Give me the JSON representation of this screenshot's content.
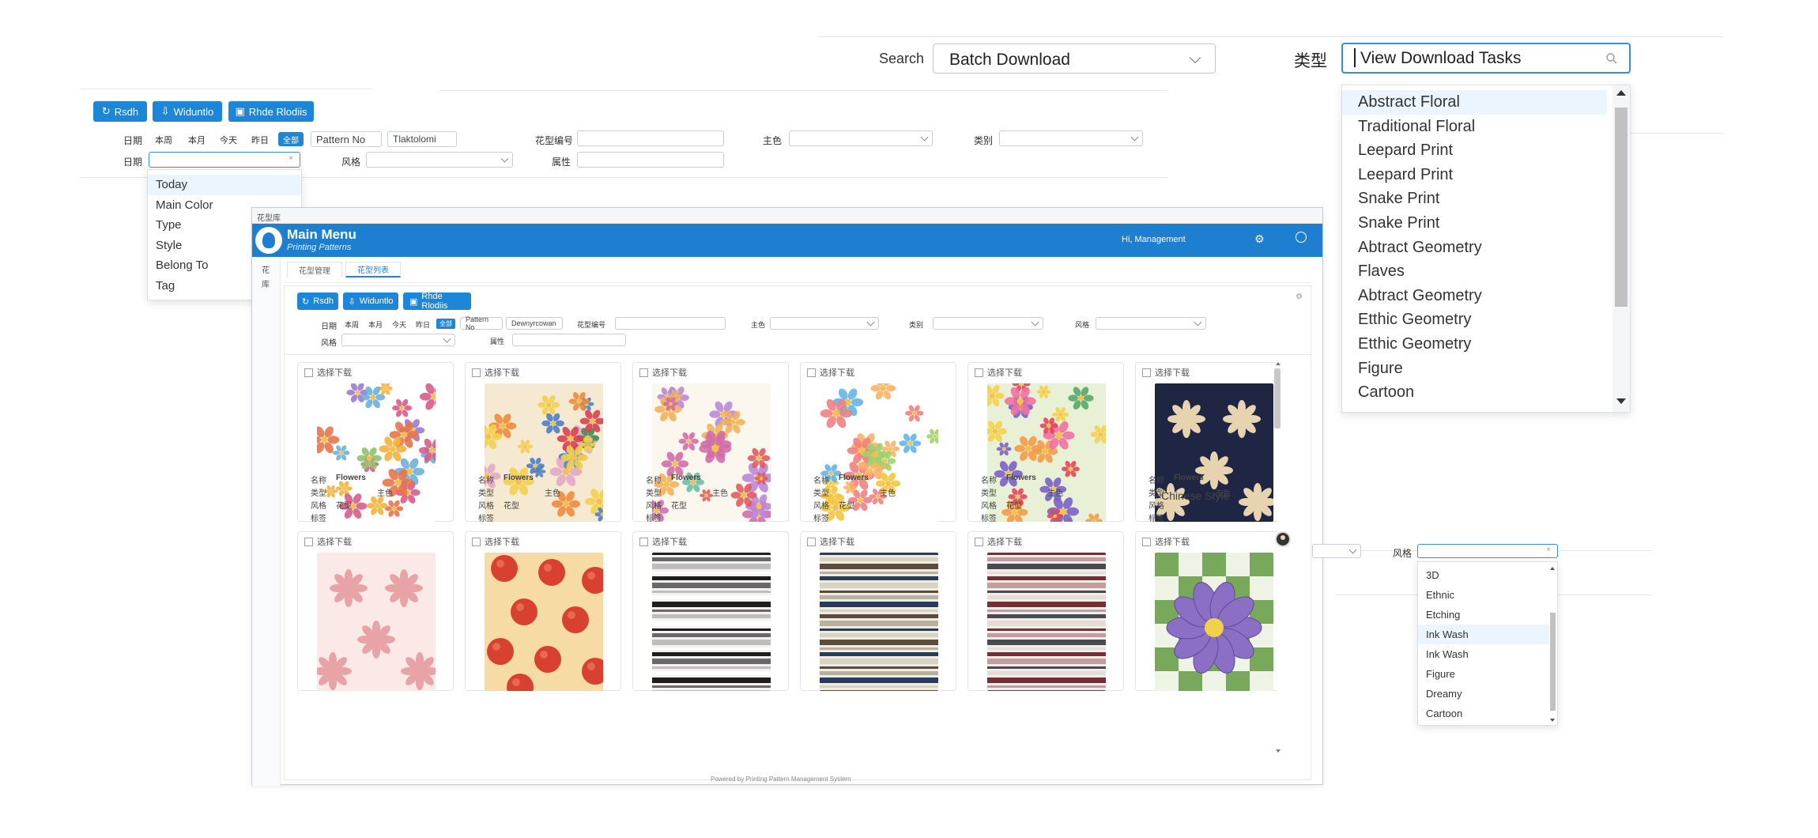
{
  "top": {
    "search_label": "Search",
    "search_value": "Batch Download",
    "type_label": "类型",
    "type_value": "View Download Tasks"
  },
  "type_dropdown": {
    "items": [
      "Abstract Floral",
      "Traditional Floral",
      "Leepard Print",
      "Leepard Print",
      "Snake Print",
      "Snake Print",
      "Abtract Geometry",
      "Flaves",
      "Abtract Geometry",
      "Etthic Geometry",
      "Etthic Geometry",
      "Figure",
      "Cartoon"
    ]
  },
  "bg_toolbar": {
    "buttons": [
      "Rsdh",
      "Widuntlo",
      "Rhde Rlodiis"
    ],
    "date_label": "日期",
    "chips": [
      "本周",
      "本月",
      "今天",
      "昨日",
      "全部"
    ],
    "pattern_no_label": "Pattern No",
    "pattern_no_value": "Tlaktolomi",
    "code_label": "花型编号",
    "color_label": "主色",
    "category_label": "类别",
    "row2_label": "日期",
    "style_label": "风格",
    "attr_label": "属性"
  },
  "filter_dropdown": {
    "items": [
      "Today",
      "Main Color",
      "Type",
      "Style",
      "Belong To",
      "Tag"
    ]
  },
  "window": {
    "tag": "花型库",
    "title": "Main Menu",
    "subtitle": "Printing Patterns",
    "right_text": "Hi, Management",
    "right_icons": [
      "gear-icon",
      "power-icon"
    ],
    "side_items": [
      "花",
      "库"
    ],
    "tabs": [
      "花型管理",
      "花型列表"
    ],
    "buttons": [
      "Rsdh",
      "Widuntlo",
      "Rhde Rlodiis"
    ],
    "filter": {
      "date_label": "日期",
      "chips": [
        "本周",
        "本月",
        "今天",
        "昨日",
        "全部"
      ],
      "pattern_no_label": "Pattern No",
      "pattern_no_value": "Dewnyrcowan",
      "code_label": "花型编号",
      "color_label": "主色",
      "category_label": "类别",
      "style_label": "风格",
      "row2_label": "风格",
      "attr_label": "属性"
    },
    "cards": [
      {
        "select": "选择下载",
        "name": "Flowers",
        "chinese_style": ""
      },
      {
        "select": "选择下载",
        "name": "Flowers",
        "chinese_style": ""
      },
      {
        "select": "选择下载",
        "name": "Flowers",
        "chinese_style": ""
      },
      {
        "select": "选择下载",
        "name": "Flowers",
        "chinese_style": ""
      },
      {
        "select": "选择下载",
        "name": "Flowers",
        "chinese_style": ""
      },
      {
        "select": "选择下载",
        "name": "Flowers",
        "chinese_style": "Chinese Style"
      },
      {
        "select": "选择下载",
        "name": "",
        "chinese_style": ""
      },
      {
        "select": "选择下载",
        "name": "",
        "chinese_style": ""
      },
      {
        "select": "选择下载",
        "name": "",
        "chinese_style": ""
      },
      {
        "select": "选择下载",
        "name": "",
        "chinese_style": ""
      },
      {
        "select": "选择下载",
        "name": "",
        "chinese_style": ""
      },
      {
        "select": "选择下载",
        "name": "",
        "chinese_style": ""
      }
    ],
    "meta_labels": [
      "名称",
      "类型",
      "风格",
      "标签"
    ],
    "meta_values": [
      "主色",
      "花型"
    ],
    "footer": "Powered by Printing Pattern Management System"
  },
  "style_field": {
    "label": "风格",
    "items": [
      "3D",
      "Ethnic",
      "Etching",
      "Ink Wash",
      "Ink Wash",
      "Figure",
      "Dreamy",
      "Cartoon"
    ]
  },
  "colors": {
    "accent": "#1e86d6",
    "header": "#1e7fd0",
    "highlight": "#eaf5fd"
  }
}
